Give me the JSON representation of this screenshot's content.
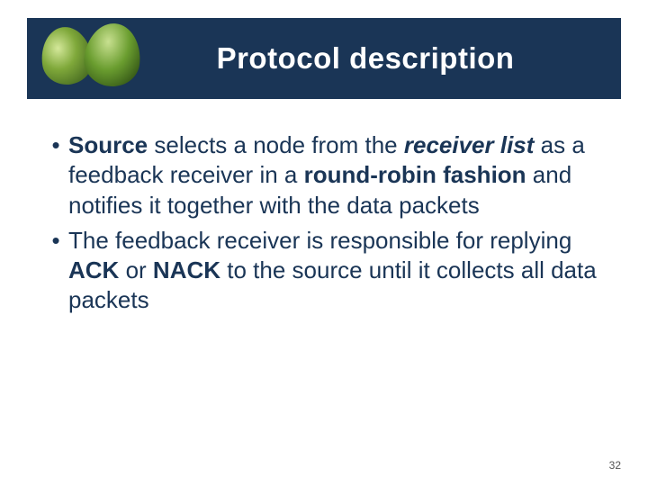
{
  "header": {
    "title": "Protocol description"
  },
  "bullets": [
    {
      "runs": [
        {
          "t": "Source",
          "cls": "b"
        },
        {
          "t": " selects a node from the ",
          "cls": ""
        },
        {
          "t": "receiver list",
          "cls": "bi"
        },
        {
          "t": " as a feedback receiver in a ",
          "cls": ""
        },
        {
          "t": "round-robin fashion",
          "cls": "b"
        },
        {
          "t": " and notifies it together with the data packets",
          "cls": ""
        }
      ]
    },
    {
      "runs": [
        {
          "t": "The feedback receiver is responsible for replying ",
          "cls": ""
        },
        {
          "t": "ACK",
          "cls": "b"
        },
        {
          "t": " or ",
          "cls": ""
        },
        {
          "t": "NACK",
          "cls": "b"
        },
        {
          "t": " to the source until it collects all data packets",
          "cls": ""
        }
      ]
    }
  ],
  "page_number": "32"
}
